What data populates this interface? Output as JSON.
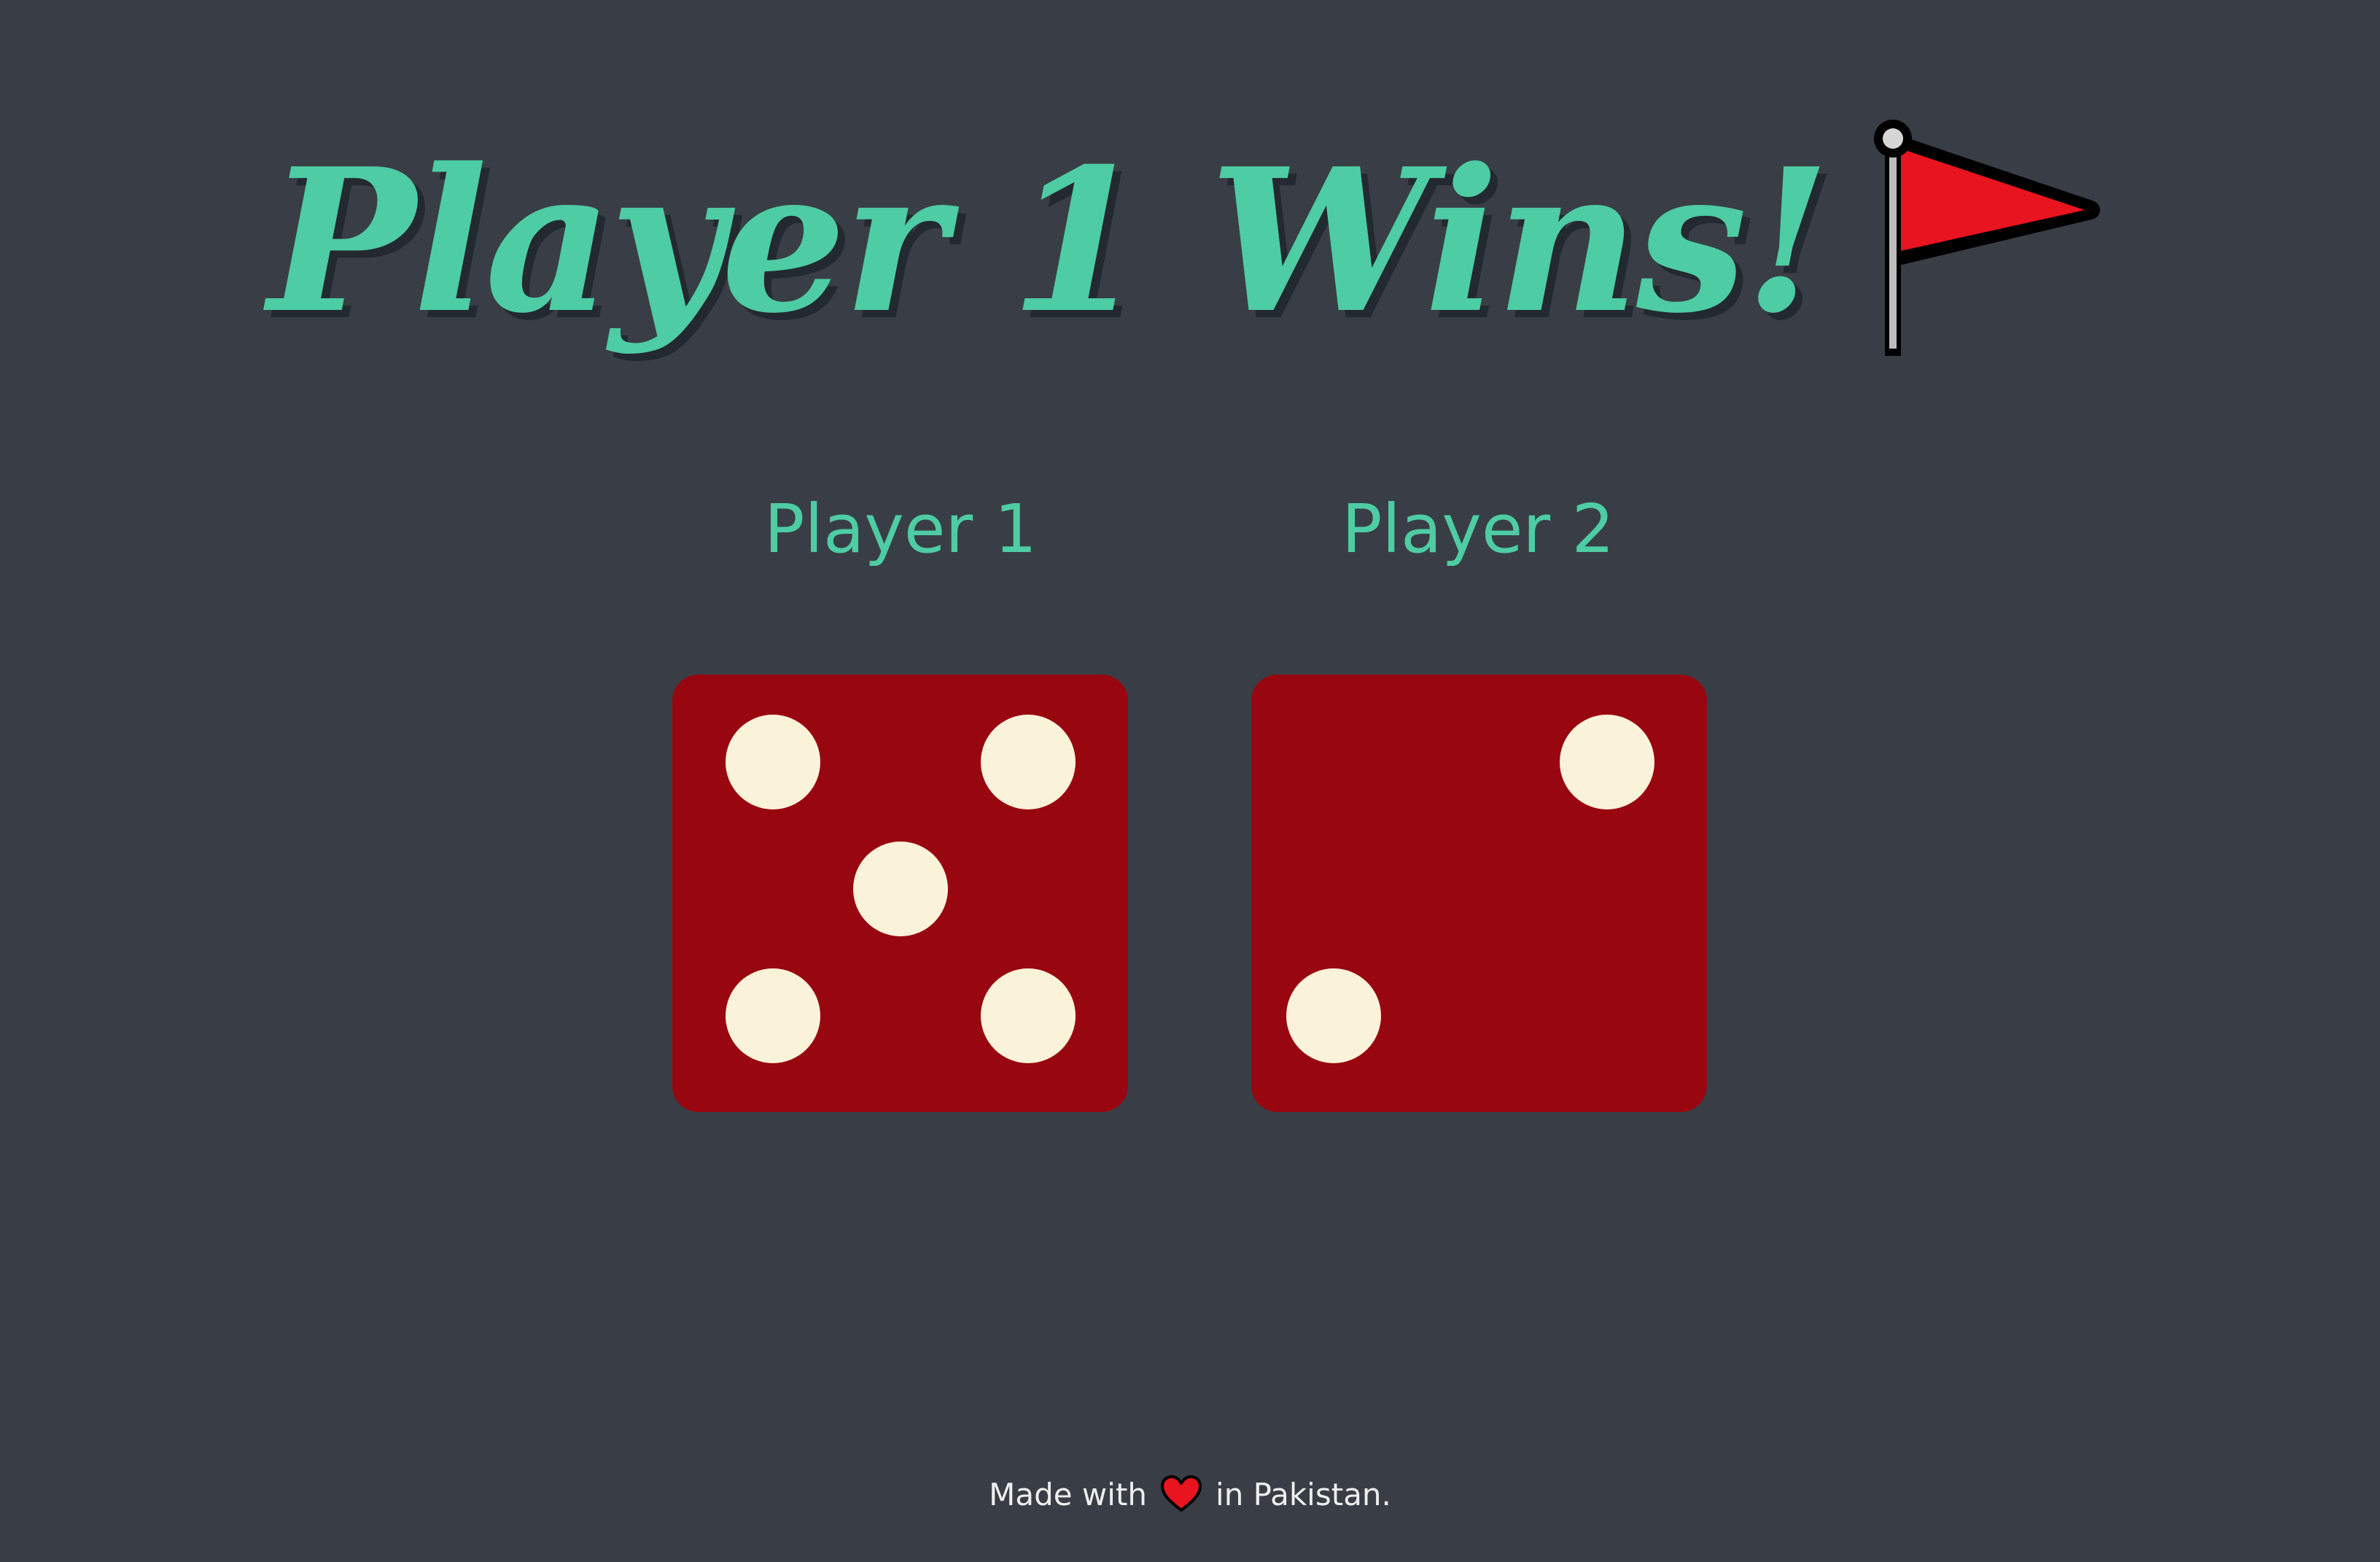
{
  "header": {
    "title": "Player 1 Wins!",
    "title_icon": "red-flag-icon"
  },
  "players": [
    {
      "label": "Player 1",
      "die_value": 5
    },
    {
      "label": "Player 2",
      "die_value": 2
    }
  ],
  "footer": {
    "prefix": "Made with",
    "icon": "heart-icon",
    "suffix": "in Pakistan."
  },
  "colors": {
    "background": "#393e46",
    "accent": "#4ecca3",
    "die": "#98060f",
    "pip": "#fbf2da",
    "flag": "#e8141f",
    "heart": "#e8141f"
  }
}
